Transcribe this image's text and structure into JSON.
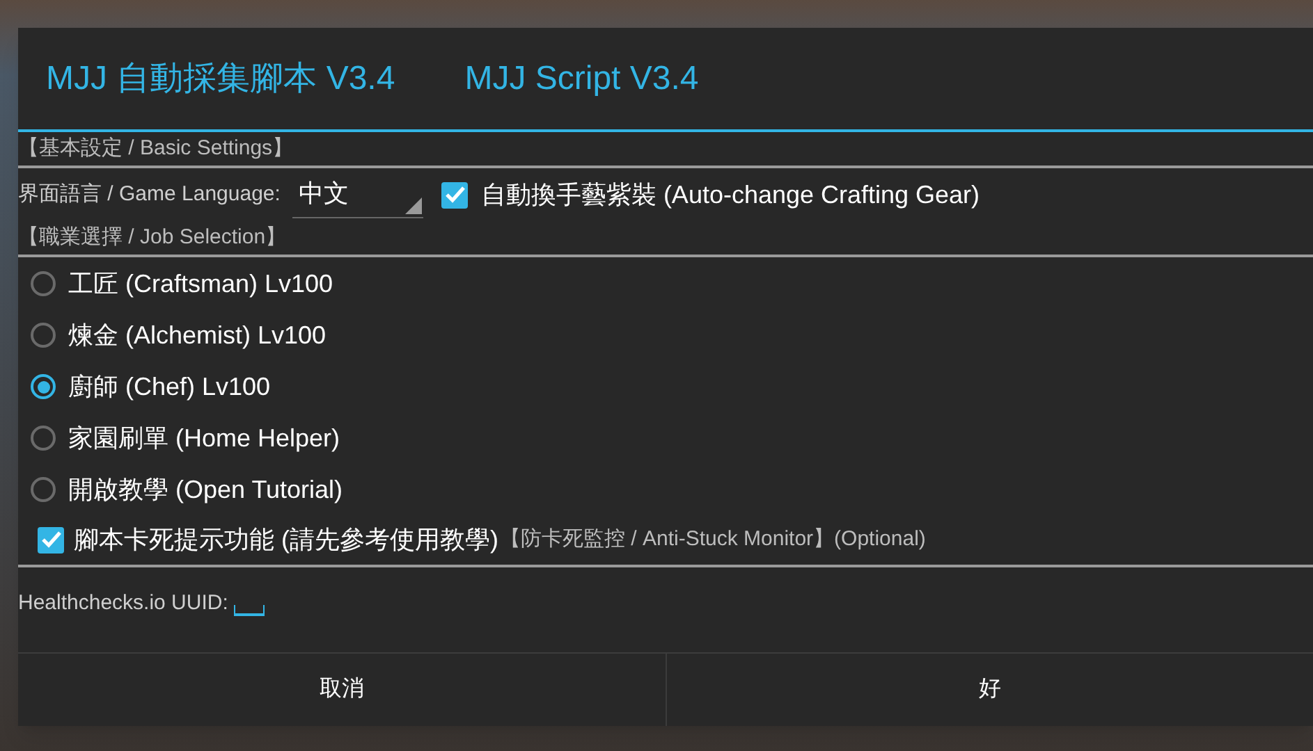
{
  "dialog": {
    "title": "MJJ 自動採集腳本 V3.4",
    "subtitle": "MJJ Script V3.4"
  },
  "basic_settings": {
    "header": "【基本設定 / Basic Settings】",
    "language_label": "界面語言 / Game Language:",
    "language_value": "中文",
    "auto_gear": {
      "label": "自動換手藝紫裝 (Auto-change Crafting Gear)",
      "checked": true
    }
  },
  "job_selection": {
    "header": "【職業選擇 / Job Selection】",
    "options": [
      {
        "label": "工匠 (Craftsman) Lv100",
        "selected": false
      },
      {
        "label": "煉金 (Alchemist) Lv100",
        "selected": false
      },
      {
        "label": "廚師 (Chef) Lv100",
        "selected": true
      },
      {
        "label": "家園刷單 (Home Helper)",
        "selected": false
      },
      {
        "label": "開啟教學 (Open Tutorial)",
        "selected": false
      }
    ]
  },
  "monitor": {
    "label": "腳本卡死提示功能 (請先參考使用教學)",
    "note": "【防卡死監控 / Anti-Stuck Monitor】(Optional)",
    "checked": true
  },
  "healthchecks": {
    "label": "Healthchecks.io UUID:"
  },
  "buttons": [
    {
      "label": "取消"
    },
    {
      "label": "好"
    }
  ]
}
